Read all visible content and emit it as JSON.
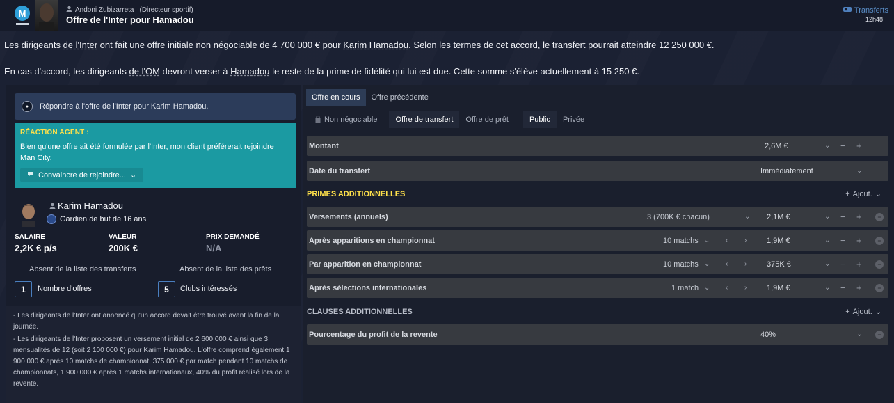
{
  "header": {
    "sender_name": "Andoni Zubizarreta",
    "sender_role": "(Directeur sportif)",
    "title": "Offre de l'Inter pour Hamadou",
    "category": "Transferts",
    "time": "12h48"
  },
  "body": {
    "p1_a": "Les dirigeants ",
    "p1_b": "de l'Inter",
    "p1_c": " ont fait une offre initiale non négociable de 4 700 000 € pour ",
    "p1_d": "Karim Hamadou",
    "p1_e": ". Selon les termes de cet accord, le transfert pourrait atteindre 12 250 000 €.",
    "p2_a": "En cas d'accord, les dirigeants ",
    "p2_b": "de l'OM",
    "p2_c": " devront verser à ",
    "p2_d": "Hamadou",
    "p2_e": " le reste de la prime de fidélité qui lui est due. Cette somme s'élève actuellement à 15 250 €."
  },
  "left": {
    "respond_label": "Répondre à l'offre de l'Inter pour Karim Hamadou.",
    "agent_title": "RÉACTION AGENT :",
    "agent_text": "Bien qu'une offre ait été formulée par l'Inter, mon client préférerait rejoindre Man City.",
    "convince_label": "Convaincre de rejoindre...",
    "player_name": "Karim Hamadou",
    "player_position": "Gardien de but de 16 ans",
    "salary_label": "SALAIRE",
    "salary_value": "2,2K € p/s",
    "value_label": "VALEUR",
    "value_value": "200K €",
    "asking_label": "PRIX DEMANDÉ",
    "asking_value": "N/A",
    "absent_transfers": "Absent de la liste des transferts",
    "absent_loans": "Absent de la liste des prêts",
    "offers_count": "1",
    "offers_label": "Nombre d'offres",
    "clubs_count": "5",
    "clubs_label": "Clubs intéressés",
    "note1": "- Les dirigeants de l'Inter ont annoncé qu'un accord devait être trouvé avant la fin de la journée.",
    "note2": "- Les dirigeants de l'Inter proposent un versement initial de 2 600 000 € ainsi que 3 mensualités de 12 (soit 2 100 000 €) pour Karim Hamadou. L'offre comprend également 1 900 000 € après 10 matchs de championnat, 375 000 € par match pendant 10 matchs de championnats, 1 900 000 € après 1 matchs internationaux, 40% du profit réalisé lors de la revente."
  },
  "right": {
    "tab_current": "Offre en cours",
    "tab_previous": "Offre précédente",
    "opt_nonneg": "Non négociable",
    "opt_transfer": "Offre de transfert",
    "opt_loan": "Offre de prêt",
    "opt_public": "Public",
    "opt_private": "Privée",
    "amount_label": "Montant",
    "amount_value": "2,6M €",
    "date_label": "Date du transfert",
    "date_value": "Immédiatement",
    "bonus_section": "PRIMES ADDITIONNELLES",
    "add_label": "Ajout.",
    "installments_label": "Versements (annuels)",
    "installments_mid": "3 (700K € chacun)",
    "installments_value": "2,1M €",
    "apps_label": "Après apparitions en championnat",
    "apps_mid": "10 matchs",
    "apps_value": "1,9M €",
    "perapp_label": "Par apparition en championnat",
    "perapp_mid": "10 matchs",
    "perapp_value": "375K €",
    "intl_label": "Après sélections internationales",
    "intl_mid": "1 match",
    "intl_value": "1,9M €",
    "clauses_section": "CLAUSES ADDITIONNELLES",
    "add2_label": "Ajout.",
    "resale_label": "Pourcentage du profit de la revente",
    "resale_value": "40%"
  },
  "colors": {
    "accent_teal": "#1b9aa2",
    "highlight_yellow": "#ffe14a",
    "link_blue": "#5a8fc9"
  }
}
